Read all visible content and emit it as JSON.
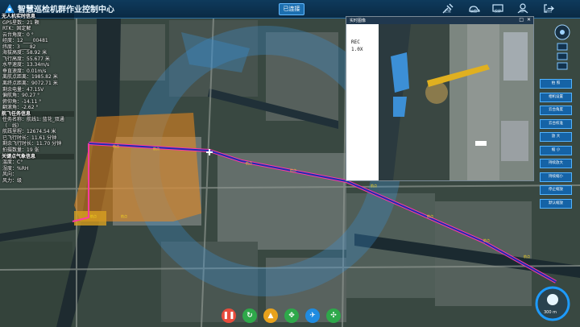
{
  "header": {
    "title": "智慧巡检机群作业控制中心",
    "connect_label": "已连接",
    "top_icons": [
      {
        "name": "satellite-icon",
        "caption": "卫星"
      },
      {
        "name": "cloud-icon",
        "caption": "云盘"
      },
      {
        "name": "screen-icon",
        "caption": "投屏"
      },
      {
        "name": "user-icon",
        "caption": "用户"
      },
      {
        "name": "exit-icon",
        "caption": "退出"
      }
    ]
  },
  "uav_info": {
    "title": "无人机实时信息",
    "rows": [
      "GPS星数：21 颗",
      "RTK：固定解",
      "云台角度：0 °",
      "经度：12____00481",
      "纬度：3____82",
      "海拔高度：58.92 米",
      "飞行高度：55.677 米",
      "水平速度：13.34m/s",
      "垂直速度：0.01m/s",
      "离航点距离：1985.82 米",
      "离终点距离：9072.71 米",
      "剩余电量：47.15V",
      "偏航角：90.27 °",
      "俯仰角：-14.11 °",
      "翻滚角：-2.62 °"
    ]
  },
  "mission_info": {
    "title": "航飞任务信息",
    "rows": [
      "任务名称：航线1: 蓝花_双通",
      "（__线）",
      "航线里程：12674.54 米",
      "已飞行时长：11.61 分钟",
      "剩余飞行时长：11.70 分钟",
      "拍摄数量：19 张"
    ]
  },
  "keypoint_info": {
    "title": "关键点气象信息",
    "rows": [
      "温度：C°",
      "湿度：%RH",
      "风向：",
      "风力：级"
    ]
  },
  "video": {
    "title": "实时图像",
    "rec": "REC",
    "zoom": "1.0X"
  },
  "right_tools": [
    "拍 照",
    "相机设置",
    "云台角度",
    "云台校准",
    "放 大",
    "缩 小",
    "持续放大",
    "持续缩小",
    "停止缩放",
    "默认缩放"
  ],
  "bottom_tools": [
    {
      "name": "pause-icon",
      "color": "#e84b3c",
      "glyph": "❚❚"
    },
    {
      "name": "return-icon",
      "color": "#2ea84a",
      "glyph": "↻"
    },
    {
      "name": "land-icon",
      "color": "#e8a21c",
      "glyph": "▲"
    },
    {
      "name": "gimbal-icon",
      "color": "#2ea84a",
      "glyph": "✥"
    },
    {
      "name": "drone-icon",
      "color": "#1f8be0",
      "glyph": "✈"
    },
    {
      "name": "hover-icon",
      "color": "#2ea84a",
      "glyph": "✣"
    }
  ],
  "map": {
    "scale_label": "300 m",
    "colors": {
      "route": "#1b2db0",
      "route_done": "#ff3aa0",
      "zone": "#f08a1c",
      "range": "#3a8fd0"
    }
  }
}
